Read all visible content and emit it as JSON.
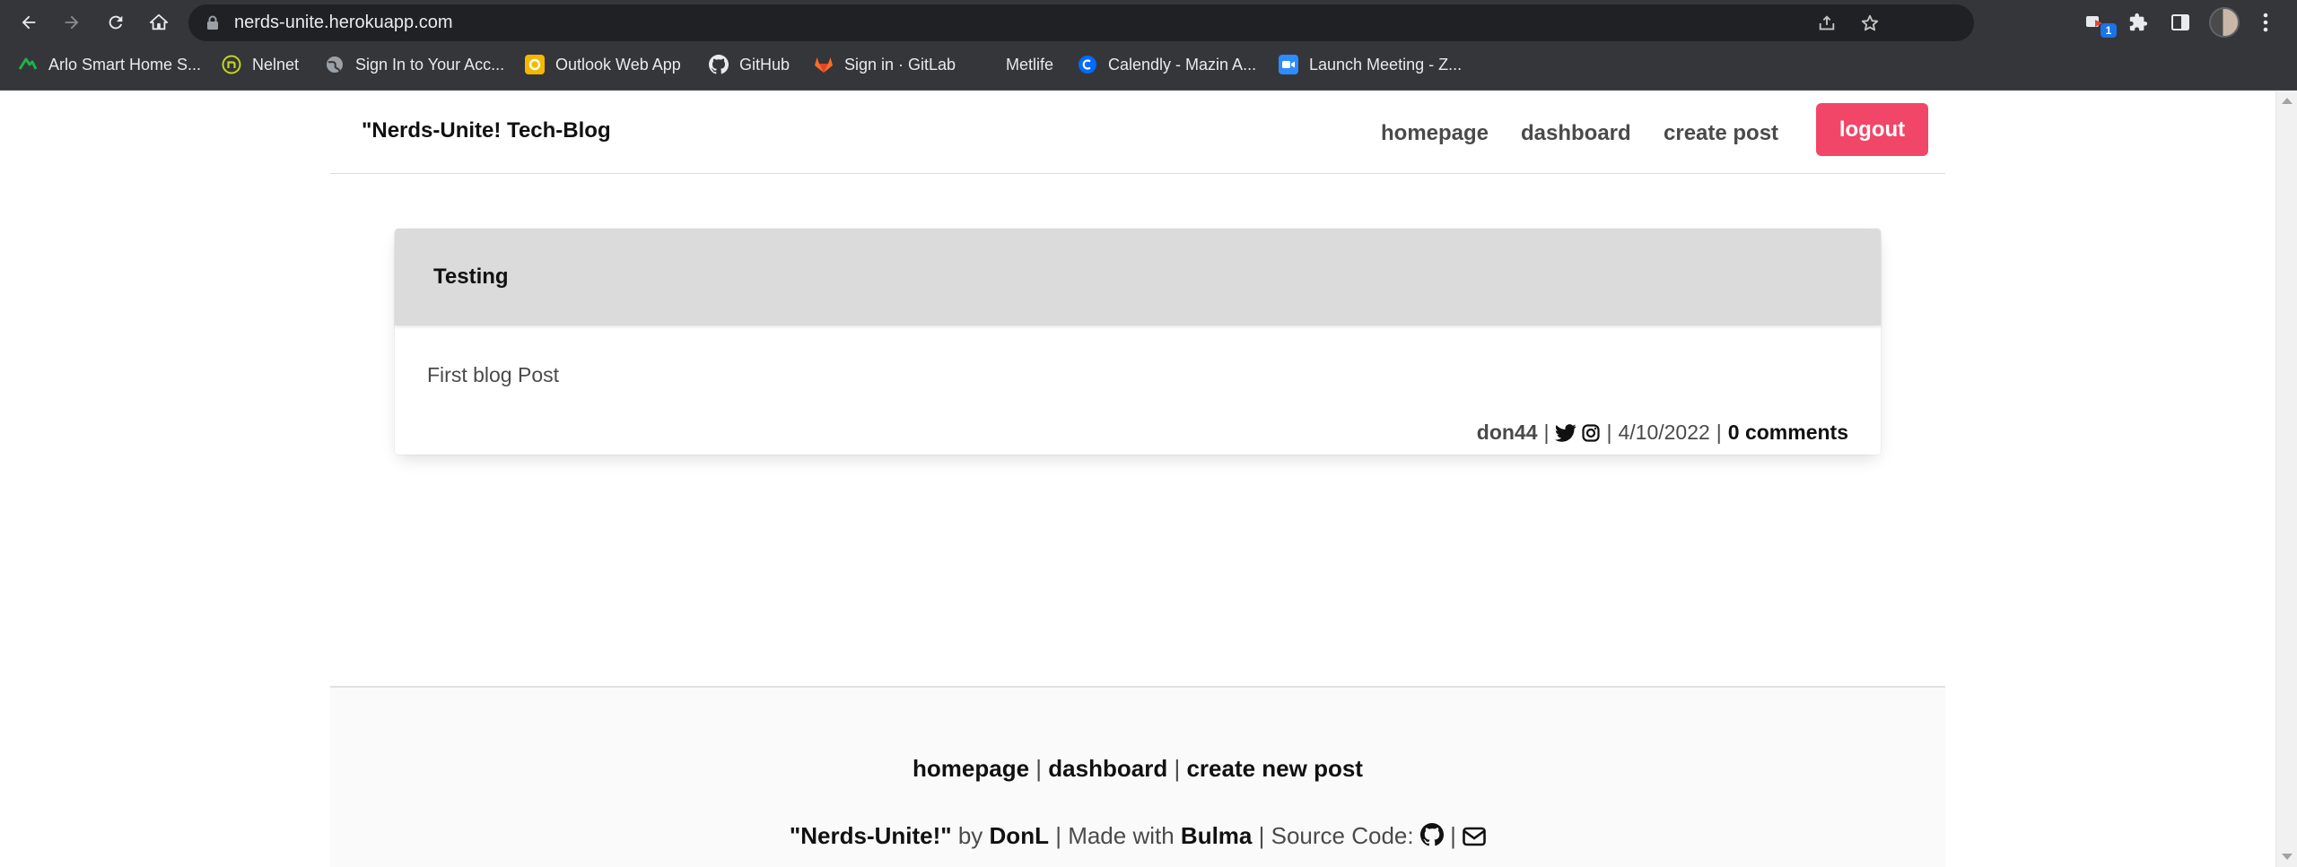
{
  "browser": {
    "url": "nerds-unite.herokuapp.com",
    "extension_badge": "1",
    "bookmarks": [
      {
        "label": "Arlo Smart Home S...",
        "icon": "arlo-icon"
      },
      {
        "label": "Nelnet",
        "icon": "nelnet-icon"
      },
      {
        "label": "Sign In to Your Acc...",
        "icon": "globe-icon"
      },
      {
        "label": "Outlook Web App",
        "icon": "outlook-icon"
      },
      {
        "label": "GitHub",
        "icon": "github-icon"
      },
      {
        "label": "Sign in · GitLab",
        "icon": "gitlab-icon"
      },
      {
        "label": "Metlife",
        "icon": "metlife-icon"
      },
      {
        "label": "Calendly - Mazin A...",
        "icon": "calendly-icon"
      },
      {
        "label": "Launch Meeting - Z...",
        "icon": "zoom-icon"
      }
    ]
  },
  "navbar": {
    "brand": "\"Nerds-Unite! Tech-Blog",
    "links": [
      "homepage",
      "dashboard",
      "create post"
    ],
    "logout": "logout"
  },
  "post": {
    "title": "Testing",
    "body": "First blog Post",
    "author": "don44",
    "date": "4/10/2022",
    "comments": "0 comments"
  },
  "footer": {
    "links": [
      "homepage",
      "dashboard",
      "create new post"
    ],
    "site_name": "\"Nerds-Unite!\"",
    "by_text": "by",
    "author": "DonL",
    "made_with_text": "Made with",
    "framework": "Bulma",
    "source_code_text": "Source Code:"
  },
  "colors": {
    "logout_button": "#f14668",
    "card_header": "#dbdbdb",
    "footer_bg": "#fafafa",
    "chrome_toolbar": "#35363a"
  }
}
